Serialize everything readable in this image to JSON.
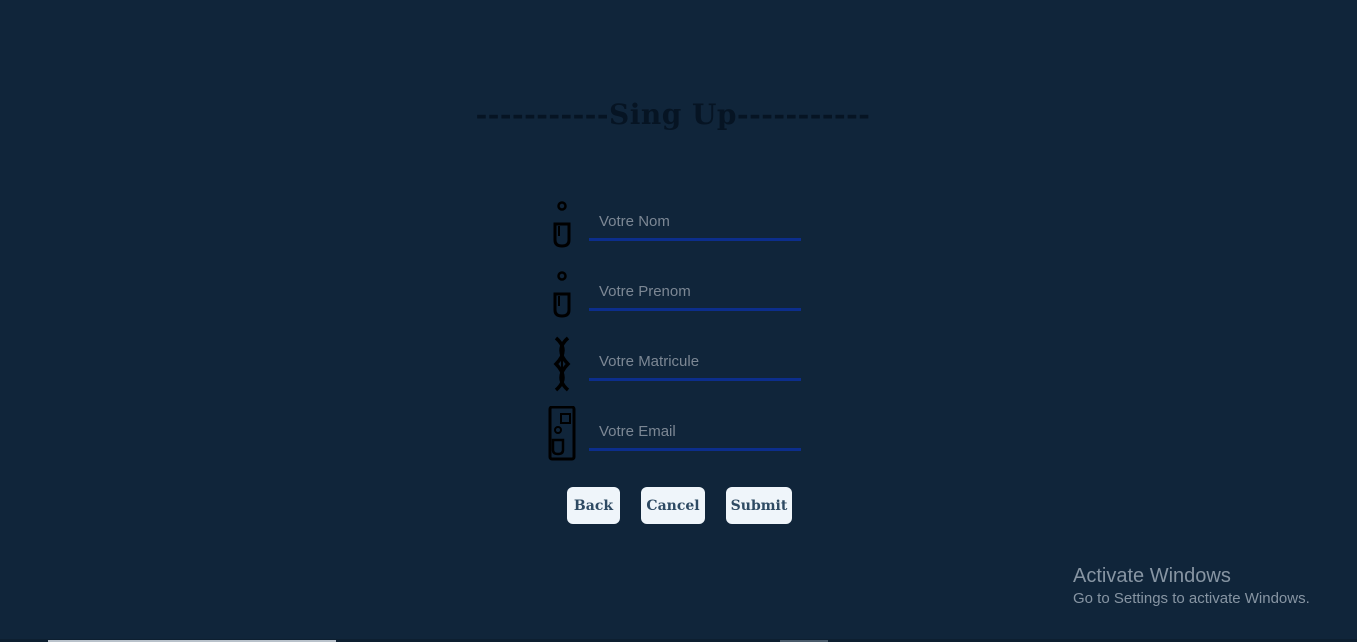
{
  "page": {
    "title": "-----------Sing Up-----------"
  },
  "form": {
    "fields": [
      {
        "name": "nom",
        "placeholder": "Votre Nom",
        "icon": "user-icon"
      },
      {
        "name": "prenom",
        "placeholder": "Votre Prenom",
        "icon": "user-icon"
      },
      {
        "name": "matricule",
        "placeholder": "Votre Matricule",
        "icon": "fingerprint-icon"
      },
      {
        "name": "email",
        "placeholder": "Votre Email",
        "icon": "id-card-icon"
      }
    ],
    "underline_color": "#0c2e8c"
  },
  "buttons": {
    "back_label": "Back",
    "cancel_label": "Cancel",
    "submit_label": "Submit"
  },
  "watermark": {
    "title": "Activate Windows",
    "subtitle": "Go to Settings to activate Windows."
  },
  "colors": {
    "background": "#10253a",
    "title": "#061423",
    "button_bg": "#eff5fa",
    "button_text": "#2e4a63"
  }
}
